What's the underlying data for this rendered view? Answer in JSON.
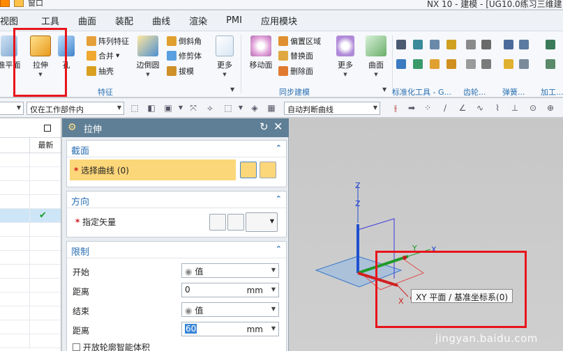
{
  "window": {
    "menu_label": "窗口",
    "title": "NX 10 - 建模 - [UG10.0练习三维建"
  },
  "menubar": [
    "视图",
    "工具",
    "曲面",
    "装配",
    "曲线",
    "渲染",
    "PMI",
    "应用模块"
  ],
  "ribbon": {
    "datum_plane": "准平面",
    "extrude": "拉伸",
    "hole": "孔",
    "pattern_feature": "阵列特征",
    "unite": "合并",
    "shell": "抽壳",
    "edge_blend": "边倒圆",
    "chamfer": "倒斜角",
    "trim_body": "修剪体",
    "draft": "拔模",
    "more1": "更多",
    "move_face": "移动面",
    "offset_region": "偏置区域",
    "replace_face": "替换面",
    "delete_face": "删除面",
    "more2": "更多",
    "surface": "曲面",
    "group_feature": "特征",
    "group_sync": "同步建模",
    "group_std_tools": "标准化工具 - G...",
    "group_gear": "齿轮...",
    "group_spring": "弹簧...",
    "group_process": "加工..."
  },
  "selection_bar": {
    "scope": "仅在工作部件内",
    "curve_rule": "自动判断曲线"
  },
  "navigator": {
    "col_latest": "最新"
  },
  "dialog": {
    "title": "拉伸",
    "section_label": "截面",
    "select_curve": "选择曲线 (0)",
    "direction_label": "方向",
    "specify_vector": "指定矢量",
    "limits_label": "限制",
    "start_label": "开始",
    "start_value": "值",
    "start_distance_label": "距离",
    "start_distance": "0",
    "end_label": "结束",
    "end_value": "值",
    "end_distance_label": "距离",
    "end_distance": "60",
    "unit": "mm",
    "open_profile": "开放轮廓智能体积"
  },
  "graphics": {
    "axis_z": "Z",
    "axis_y": "Y",
    "axis_x": "X",
    "tooltip": "XY 平面 / 基准坐标系(0)",
    "watermark": "jingyan.baidu.com"
  },
  "colors": {
    "highlight": "#e8141b",
    "dialog_title": "#5f7f96",
    "selection_bar": "#fcd77a",
    "group_label": "#2a6fb0"
  }
}
